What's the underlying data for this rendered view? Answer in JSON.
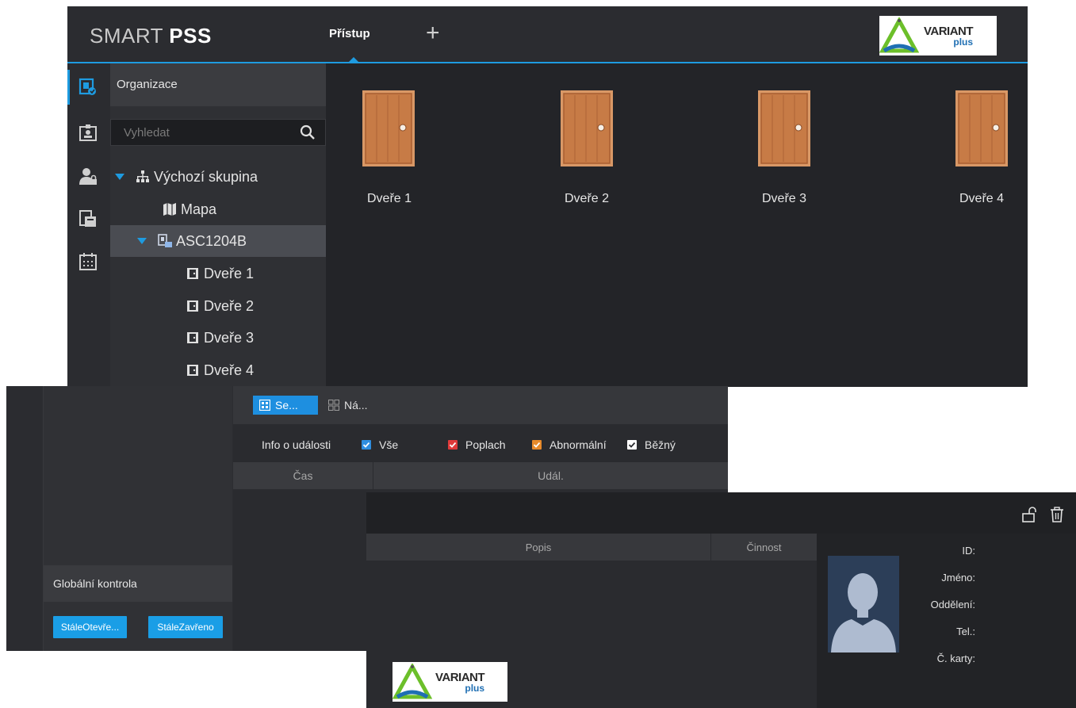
{
  "app": {
    "title_light": "SM",
    "title_light2": "ART ",
    "title_bold": "PSS",
    "active_tab": "Přístup",
    "add_tab": "+"
  },
  "logo": {
    "line1": "VARIANT",
    "line2": "plus"
  },
  "org": {
    "title": "Organizace",
    "search_placeholder": "Vyhledat",
    "tree": [
      {
        "label": "Výchozí skupina",
        "icon": "group-tree-icon"
      },
      {
        "label": "Mapa",
        "icon": "map-icon"
      },
      {
        "label": "ASC1204B",
        "icon": "device-icon"
      },
      {
        "label": "Dveře 1",
        "icon": "door-small-icon"
      },
      {
        "label": "Dveře 2",
        "icon": "door-small-icon"
      },
      {
        "label": "Dveře 3",
        "icon": "door-small-icon"
      },
      {
        "label": "Dveře 4",
        "icon": "door-small-icon"
      }
    ]
  },
  "doors": [
    {
      "label": "Dveře 1"
    },
    {
      "label": "Dveře 2"
    },
    {
      "label": "Dveře 3"
    },
    {
      "label": "Dveře 4"
    }
  ],
  "events": {
    "tab_se": "Se...",
    "tab_na": "Ná...",
    "filter_label": "Info o události",
    "filters": [
      {
        "label": "Vše",
        "color": "#2f8ee0"
      },
      {
        "label": "Poplach",
        "color": "#e03a3a"
      },
      {
        "label": "Abnormální",
        "color": "#e88a2a"
      },
      {
        "label": "Běžný",
        "color": "#ffffff"
      }
    ],
    "col_time": "Čas",
    "col_event": "Udál."
  },
  "global": {
    "label": "Globální kontrola",
    "btn_open": "StáleOtevře...",
    "btn_closed": "StáleZavřeno"
  },
  "details": {
    "col_desc": "Popis",
    "col_action": "Činnost",
    "fields": {
      "id": "ID:",
      "name": "Jméno:",
      "dept": "Oddělení:",
      "tel": "Tel.:",
      "card": "Č. karty:"
    }
  },
  "colors": {
    "accent": "#1e9be0",
    "door": "#c97a45",
    "button": "#1a9ee6"
  }
}
